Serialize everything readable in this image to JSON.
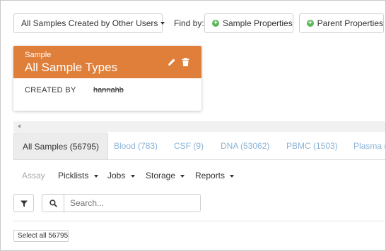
{
  "view_selector": {
    "label": "All Samples Created by Other Users"
  },
  "find_by": {
    "label": "Find by:",
    "sample_properties": "Sample Properties",
    "parent_properties": "Parent Properties"
  },
  "card": {
    "subtitle": "Sample",
    "title": "All Sample Types",
    "field_label": "CREATED BY",
    "field_value": "hannahb"
  },
  "tabs": [
    {
      "label": "All Samples (56795)"
    },
    {
      "label": "Blood (783)"
    },
    {
      "label": "CSF (9)"
    },
    {
      "label": "DNA (53062)"
    },
    {
      "label": "PBMC (1503)"
    },
    {
      "label": "Plasma ("
    }
  ],
  "toolbar": {
    "assay": "Assay",
    "picklists": "Picklists",
    "jobs": "Jobs",
    "storage": "Storage",
    "reports": "Reports"
  },
  "search": {
    "placeholder": "Search..."
  },
  "select_all": {
    "label": "Select all 56795"
  },
  "colors": {
    "card_header": "#e07f3a",
    "plus_icon": "#5cb85c",
    "tab_link": "#8ab4d8",
    "active_tab_bg": "#ececec"
  }
}
